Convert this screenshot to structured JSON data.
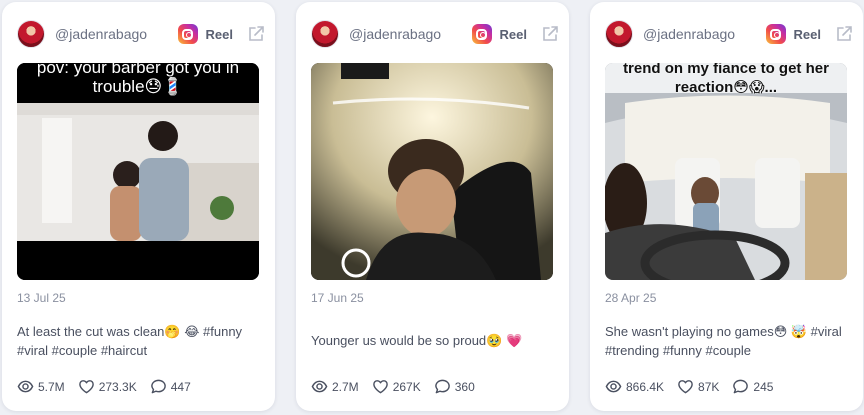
{
  "posts": [
    {
      "username": "@jadenrabago",
      "platform_label": "Reel",
      "media_overlay_text": "pov: your barber got you in trouble😓💈",
      "date": "13 Jul 25",
      "caption": "At least the cut was clean🤭 😂 #funny #viral #couple #haircut",
      "views": "5.7M",
      "likes": "273.3K",
      "comments": "447"
    },
    {
      "username": "@jadenrabago",
      "platform_label": "Reel",
      "media_overlay_text": "",
      "date": "17 Jun 25",
      "caption": "Younger us would be so proud🥹 💗",
      "views": "2.7M",
      "likes": "267K",
      "comments": "360"
    },
    {
      "username": "@jadenrabago",
      "platform_label": "Reel",
      "media_overlay_text": "trend on my fiance to get her reaction😳😱...",
      "date": "28 Apr 25",
      "caption": "She wasn't playing no games😳 🤯 #viral #trending #funny #couple",
      "views": "866.4K",
      "likes": "87K",
      "comments": "245"
    }
  ],
  "icons": {
    "platform": "instagram-icon",
    "external": "external-link-icon",
    "views": "eye-icon",
    "likes": "heart-icon",
    "comments": "comment-icon"
  },
  "colors": {
    "background": "#eef0f5",
    "card": "#ffffff",
    "muted_text": "#8a90a0"
  }
}
